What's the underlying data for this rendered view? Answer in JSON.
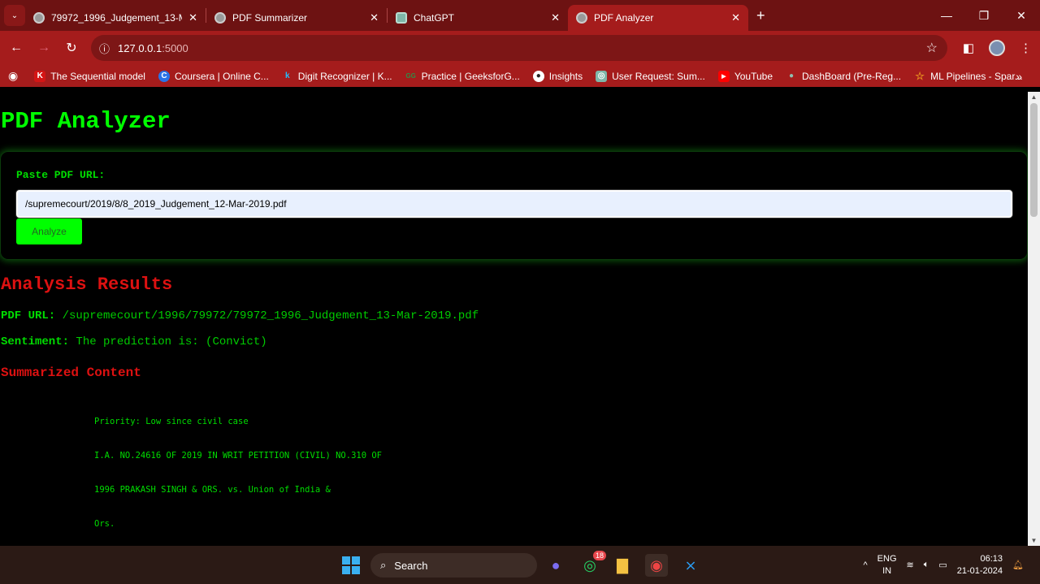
{
  "browser": {
    "tabs": [
      {
        "title": "79972_1996_Judgement_13-Ma",
        "icon": "globe-icon",
        "active": false
      },
      {
        "title": "PDF Summarizer",
        "icon": "globe-icon",
        "active": false
      },
      {
        "title": "ChatGPT",
        "icon": "chatgpt-icon",
        "active": false
      },
      {
        "title": "PDF Analyzer",
        "icon": "globe-icon",
        "active": true
      }
    ],
    "url_host": "127.0.0.1",
    "url_port": ":5000",
    "bookmarks": [
      {
        "label": "The Sequential model",
        "icon": "K",
        "color": "#d41515"
      },
      {
        "label": "Coursera | Online C...",
        "icon": "C",
        "color": "#2a73e8"
      },
      {
        "label": "Digit Recognizer | K...",
        "icon": "k",
        "color": "#20beff"
      },
      {
        "label": "Practice | GeeksforG...",
        "icon": "GG",
        "color": "#2f8d46"
      },
      {
        "label": "Insights",
        "icon": "●",
        "color": "#222"
      },
      {
        "label": "User Request: Sum...",
        "icon": "◎",
        "color": "#7fb6a8"
      },
      {
        "label": "YouTube",
        "icon": "▶",
        "color": "#ff0000"
      },
      {
        "label": "DashBoard (Pre-Reg...",
        "icon": "●",
        "color": "#8fbfb0"
      },
      {
        "label": "ML Pipelines - Spar...",
        "icon": "☆",
        "color": "#e58a1f"
      }
    ]
  },
  "page": {
    "title": "PDF Analyzer",
    "form": {
      "label": "Paste PDF URL:",
      "input_value": "/supremecourt/2019/8/8_2019_Judgement_12-Mar-2019.pdf",
      "button": "Analyze"
    },
    "results": {
      "heading": "Analysis Results",
      "pdf_url_label": "PDF URL:",
      "pdf_url": "/supremecourt/1996/79972/79972_1996_Judgement_13-Mar-2019.pdf",
      "sentiment_label": "Sentiment:",
      "sentiment": "The prediction is: (Convict)",
      "summary_heading": "Summarized Content",
      "summary_lines": [
        "Priority: Low since civil case",
        "I.A. NO.24616 OF 2019 IN WRIT PETITION (CIVIL) NO.310 OF",
        "1996 PRAKASH SINGH & ORS. vs. Union of India &",
        "Ors."
      ]
    }
  },
  "taskbar": {
    "search": "Search",
    "whatsapp_badge": "18",
    "lang1": "ENG",
    "lang2": "IN",
    "time": "06:13",
    "date": "21-01-2024"
  },
  "colors": {
    "accent_green": "#00ff00",
    "heading_red": "#dd1111",
    "chrome_theme": "#a51c1c"
  }
}
